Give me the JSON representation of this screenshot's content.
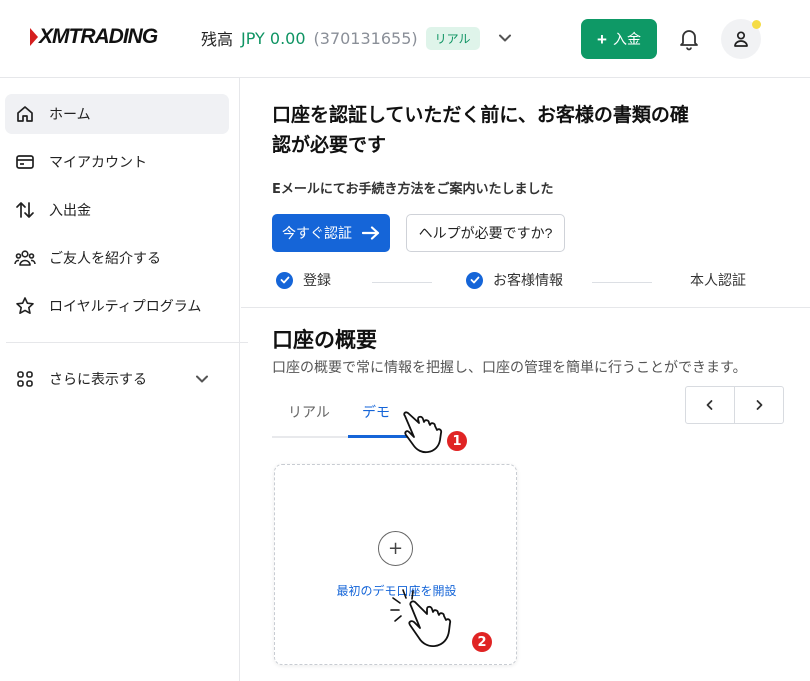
{
  "header": {
    "logo_text": "XMTRADING",
    "balance_label": "残高",
    "balance_amount": "JPY 0.00",
    "account_number": "(370131655)",
    "account_type": "リアル",
    "deposit_label": "入金"
  },
  "sidebar": {
    "items": [
      {
        "label": "ホーム",
        "icon": "home-icon"
      },
      {
        "label": "マイアカウント",
        "icon": "card-icon"
      },
      {
        "label": "入出金",
        "icon": "transfer-icon"
      },
      {
        "label": "ご友人を紹介する",
        "icon": "people-icon"
      },
      {
        "label": "ロイヤルティプログラム",
        "icon": "star-icon"
      }
    ],
    "more_label": "さらに表示する"
  },
  "verification": {
    "title_line1": "口座を認証していただく前に、お客様の書類の確",
    "title_line2": "認が必要です",
    "subtitle": "Eメールにてお手続き方法をご案内いたしました",
    "verify_button": "今すぐ認証",
    "help_button": "ヘルプが必要ですか?",
    "steps": [
      {
        "label": "登録",
        "done": true
      },
      {
        "label": "お客様情報",
        "done": true
      },
      {
        "label": "本人認証",
        "done": false
      }
    ]
  },
  "overview": {
    "title": "口座の概要",
    "subtitle": "口座の概要で常に情報を把握し、口座の管理を簡単に行うことができます。",
    "tabs": [
      {
        "label": "リアル",
        "active": false
      },
      {
        "label": "デモ",
        "active": true
      }
    ],
    "open_demo_label": "最初のデモ口座を開設"
  },
  "annotations": {
    "marker1": "1",
    "marker2": "2"
  },
  "colors": {
    "brand_green": "#0e9966",
    "primary_blue": "#1565d8",
    "marker_red": "#e02424"
  }
}
